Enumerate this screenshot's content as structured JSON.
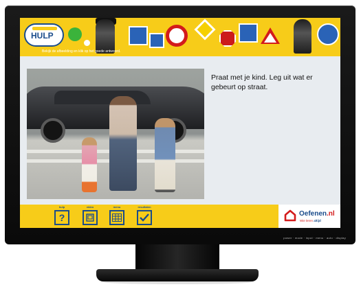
{
  "header": {
    "logo_text": "HULP",
    "instruction": "Bekijk de afbeelding en klik op het goede antwoord."
  },
  "content": {
    "caption": "Praat met je kind. Leg uit wat er gebeurt op straat."
  },
  "nav": {
    "items": [
      {
        "label": "hulp",
        "icon": "question-icon",
        "glyph": "?"
      },
      {
        "label": "video",
        "icon": "video-icon",
        "glyph": ""
      },
      {
        "label": "menu",
        "icon": "menu-grid-icon",
        "glyph": ""
      },
      {
        "label": "resultaten",
        "icon": "checkmark-icon",
        "glyph": ""
      }
    ]
  },
  "brand": {
    "name": "Oefenen",
    "tld": ".nl",
    "tagline_pre": "Wie leren ",
    "tagline_bold": "altijd"
  },
  "monitor": {
    "bezel_text": "power · mode · input · menu · auto · display"
  },
  "colors": {
    "accent_yellow": "#f7cc19",
    "brand_blue": "#1a4c8b",
    "brand_red": "#d31b1b"
  }
}
